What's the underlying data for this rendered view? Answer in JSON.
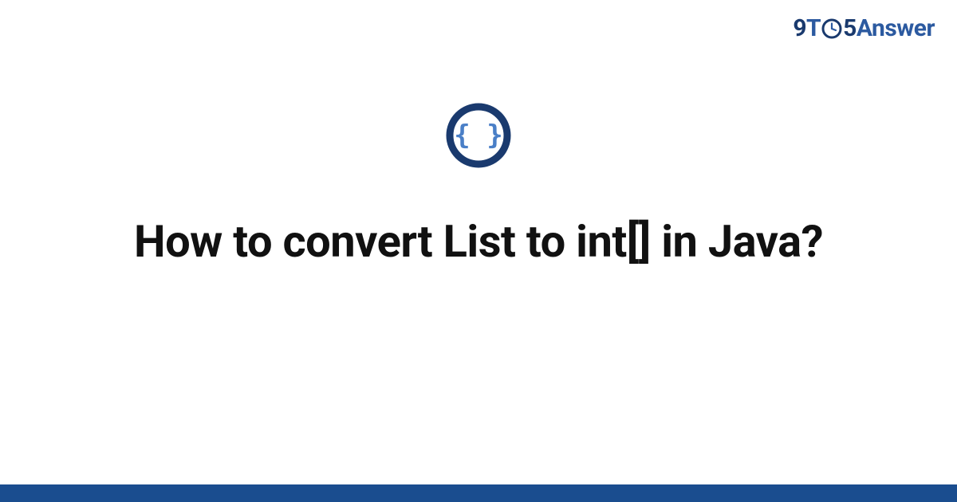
{
  "brand": {
    "nine": "9",
    "t": "T",
    "five": "5",
    "answer": "Answer"
  },
  "icon": {
    "name": "code-braces-icon"
  },
  "title": "How to convert List to int[] in Java?",
  "colors": {
    "brand_dark": "#1a3a6e",
    "brand_mid": "#2c5aa0",
    "icon_ring": "#1a3a6e",
    "icon_brace": "#4a7fc7",
    "footer": "#1a4d8f"
  }
}
